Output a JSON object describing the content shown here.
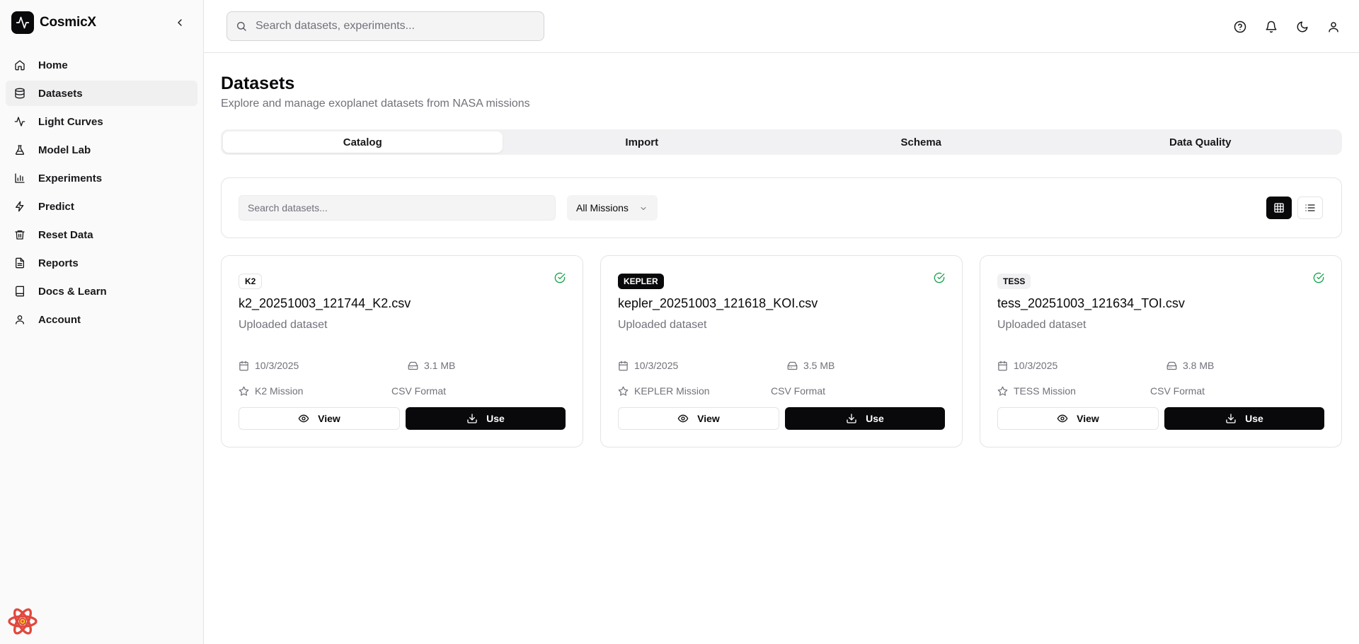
{
  "app": {
    "name": "CosmicX"
  },
  "sidebar": {
    "items": [
      {
        "label": "Home",
        "icon": "home-icon",
        "active": false
      },
      {
        "label": "Datasets",
        "icon": "database-icon",
        "active": true
      },
      {
        "label": "Light Curves",
        "icon": "activity-icon",
        "active": false
      },
      {
        "label": "Model Lab",
        "icon": "flask-icon",
        "active": false
      },
      {
        "label": "Experiments",
        "icon": "bar-chart-icon",
        "active": false
      },
      {
        "label": "Predict",
        "icon": "zap-icon",
        "active": false
      },
      {
        "label": "Reset Data",
        "icon": "trash-icon",
        "active": false
      },
      {
        "label": "Reports",
        "icon": "file-text-icon",
        "active": false
      },
      {
        "label": "Docs & Learn",
        "icon": "book-icon",
        "active": false
      },
      {
        "label": "Account",
        "icon": "user-icon",
        "active": false
      }
    ]
  },
  "topbar": {
    "search_placeholder": "Search datasets, experiments...",
    "icons": [
      "help-icon",
      "bell-icon",
      "moon-icon",
      "user-icon"
    ]
  },
  "page": {
    "title": "Datasets",
    "subtitle": "Explore and manage exoplanet datasets from NASA missions"
  },
  "tabs": [
    {
      "label": "Catalog",
      "active": true
    },
    {
      "label": "Import",
      "active": false
    },
    {
      "label": "Schema",
      "active": false
    },
    {
      "label": "Data Quality",
      "active": false
    }
  ],
  "filters": {
    "search_placeholder": "Search datasets...",
    "mission_select": "All Missions",
    "view_mode": "grid"
  },
  "datasets": [
    {
      "badge": "K2",
      "badge_style": "outline",
      "filename": "k2_20251003_121744_K2.csv",
      "description": "Uploaded dataset",
      "date": "10/3/2025",
      "size": "3.1 MB",
      "mission": "K2 Mission",
      "format": "CSV Format",
      "view_label": "View",
      "use_label": "Use"
    },
    {
      "badge": "KEPLER",
      "badge_style": "solid",
      "filename": "kepler_20251003_121618_KOI.csv",
      "description": "Uploaded dataset",
      "date": "10/3/2025",
      "size": "3.5 MB",
      "mission": "KEPLER Mission",
      "format": "CSV Format",
      "view_label": "View",
      "use_label": "Use"
    },
    {
      "badge": "TESS",
      "badge_style": "secondary",
      "filename": "tess_20251003_121634_TOI.csv",
      "description": "Uploaded dataset",
      "date": "10/3/2025",
      "size": "3.8 MB",
      "mission": "TESS Mission",
      "format": "CSV Format",
      "view_label": "View",
      "use_label": "Use"
    }
  ],
  "colors": {
    "primary": "#09090b",
    "muted_text": "#71717a",
    "border": "#e4e4e7",
    "success": "#16a34a",
    "sidebar_bg": "#fafafa",
    "react_logo": "#e0483d"
  }
}
